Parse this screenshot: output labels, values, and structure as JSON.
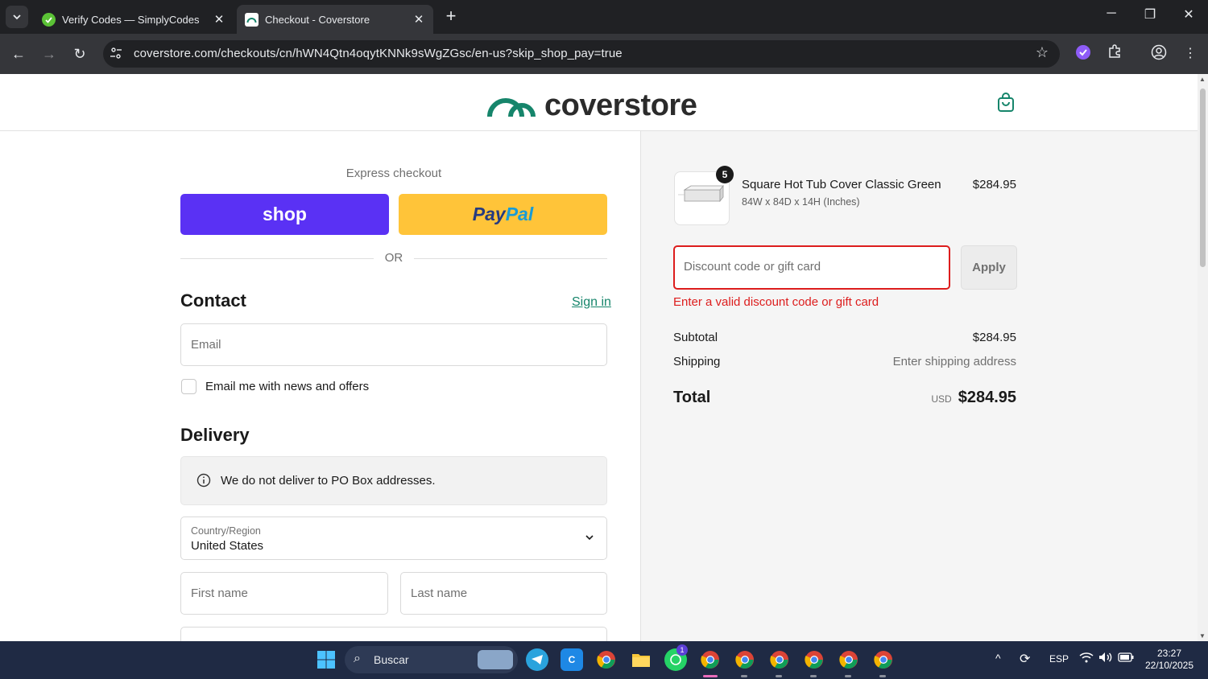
{
  "browser": {
    "tabs": [
      {
        "title": "Verify Codes — SimplyCodes",
        "active": false
      },
      {
        "title": "Checkout - Coverstore",
        "active": true
      }
    ],
    "url": "coverstore.com/checkouts/cn/hWN4Qtn4oqytKNNk9sWgZGsc/en-us?skip_shop_pay=true"
  },
  "site": {
    "logo_text": "coverstore",
    "brand_color": "#16856b"
  },
  "checkout": {
    "express_label": "Express checkout",
    "shop_label": "shop",
    "paypal_part1": "Pay",
    "paypal_part2": "Pal",
    "or_label": "OR",
    "contact_heading": "Contact",
    "sign_in": "Sign in",
    "email_placeholder": "Email",
    "news_label": "Email me with news and offers",
    "delivery_heading": "Delivery",
    "po_notice": "We do not deliver to PO Box addresses.",
    "country_label": "Country/Region",
    "country_value": "United States",
    "first_name_placeholder": "First name",
    "last_name_placeholder": "Last name"
  },
  "summary": {
    "product": {
      "quantity": "5",
      "name": "Square Hot Tub Cover Classic Green",
      "variant": "84W x 84D x 14H (Inches)",
      "price": "$284.95"
    },
    "discount_placeholder": "Discount code or gift card",
    "apply_label": "Apply",
    "error": "Enter a valid discount code or gift card",
    "subtotal_label": "Subtotal",
    "subtotal_value": "$284.95",
    "shipping_label": "Shipping",
    "shipping_value": "Enter shipping address",
    "total_label": "Total",
    "currency": "USD",
    "total_value": "$284.95"
  },
  "taskbar": {
    "search_label": "Buscar",
    "language": "ESP",
    "time": "23:27",
    "date": "22/10/2025",
    "whatsapp_badge": "1"
  }
}
